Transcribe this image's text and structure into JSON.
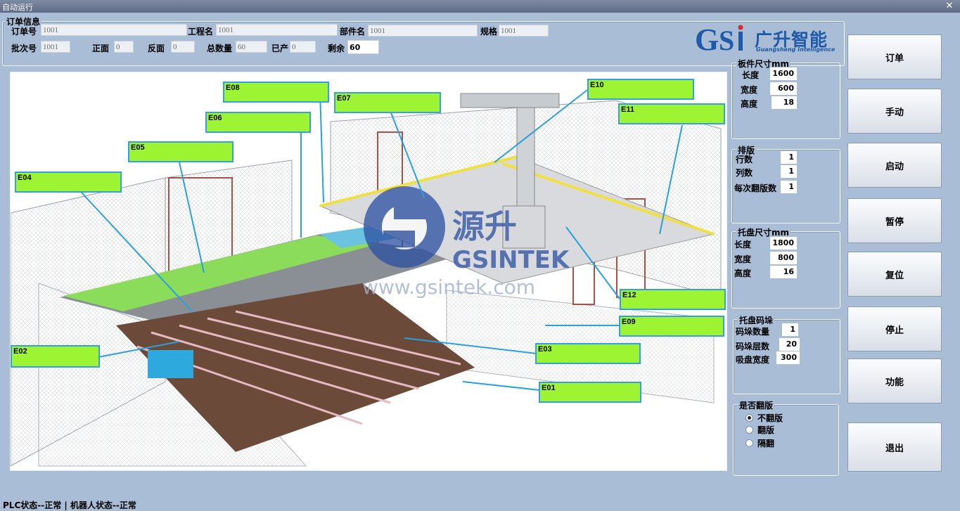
{
  "window": {
    "title": "自动运行",
    "close_glyph": "✕"
  },
  "order_info": {
    "title": "订单信息",
    "order_no_label": "订单号",
    "order_no": "1001",
    "project_label": "工程名",
    "project": "1001",
    "part_label": "部件名",
    "part": "1001",
    "spec_label": "规格",
    "spec": "1001",
    "batch_label": "批次号",
    "batch": "1001",
    "front_label": "正面",
    "front": "0",
    "back_label": "反面",
    "back": "0",
    "total_label": "总数量",
    "total": "60",
    "produced_label": "已产",
    "produced": "0",
    "remaining_label": "剩余",
    "remaining": "60"
  },
  "logo": {
    "mark": "GSi",
    "cn": "广升智能",
    "en": "Guangsheng Intelligence",
    "accent": "#1e5aa8",
    "red": "#d92b2b"
  },
  "watermark": {
    "cn": "源升",
    "en": "GSINTEK",
    "url": "www.gsintek.com"
  },
  "stations": [
    {
      "id": "E01",
      "label": "E01"
    },
    {
      "id": "E02",
      "label": "E02"
    },
    {
      "id": "E03",
      "label": "E03"
    },
    {
      "id": "E04",
      "label": "E04"
    },
    {
      "id": "E05",
      "label": "E05"
    },
    {
      "id": "E06",
      "label": "E06"
    },
    {
      "id": "E07",
      "label": "E07"
    },
    {
      "id": "E08",
      "label": "E08"
    },
    {
      "id": "E09",
      "label": "E09"
    },
    {
      "id": "E10",
      "label": "E10"
    },
    {
      "id": "E11",
      "label": "E11"
    },
    {
      "id": "E12",
      "label": "E12"
    }
  ],
  "board_size": {
    "title": "板件尺寸mm",
    "length_label": "长度",
    "length": "1600",
    "width_label": "宽度",
    "width": "600",
    "height_label": "高度",
    "height": "18"
  },
  "layout": {
    "title": "排版",
    "rows_label": "行数",
    "rows": "1",
    "cols_label": "列数",
    "cols": "1",
    "flip_label": "每次翻版数",
    "flip": "1"
  },
  "pallet_size": {
    "title": "托盘尺寸mm",
    "length_label": "长度",
    "length": "1800",
    "width_label": "宽度",
    "width": "800",
    "height_label": "高度",
    "height": "16"
  },
  "pallet_stack": {
    "title": "托盘码垛",
    "count_label": "码垛数量",
    "count": "1",
    "layers_label": "码垛层数",
    "layers": "20",
    "suction_label": "吸盘宽度",
    "suction": "300"
  },
  "flip_mode": {
    "title": "是否翻版",
    "options": [
      "不翻版",
      "翻版",
      "隔翻"
    ],
    "selected": 0
  },
  "buttons": {
    "order": "订单",
    "manual": "手动",
    "start": "启动",
    "pause": "暂停",
    "reset": "复位",
    "stop": "停止",
    "function": "功能",
    "exit": "退出"
  },
  "status_bar": "PLC状态--正常 | 机器人状态--正常",
  "colors": {
    "label_fill": "#9cf433",
    "label_border": "#33a1e0",
    "leader": "#2aa0dc"
  }
}
